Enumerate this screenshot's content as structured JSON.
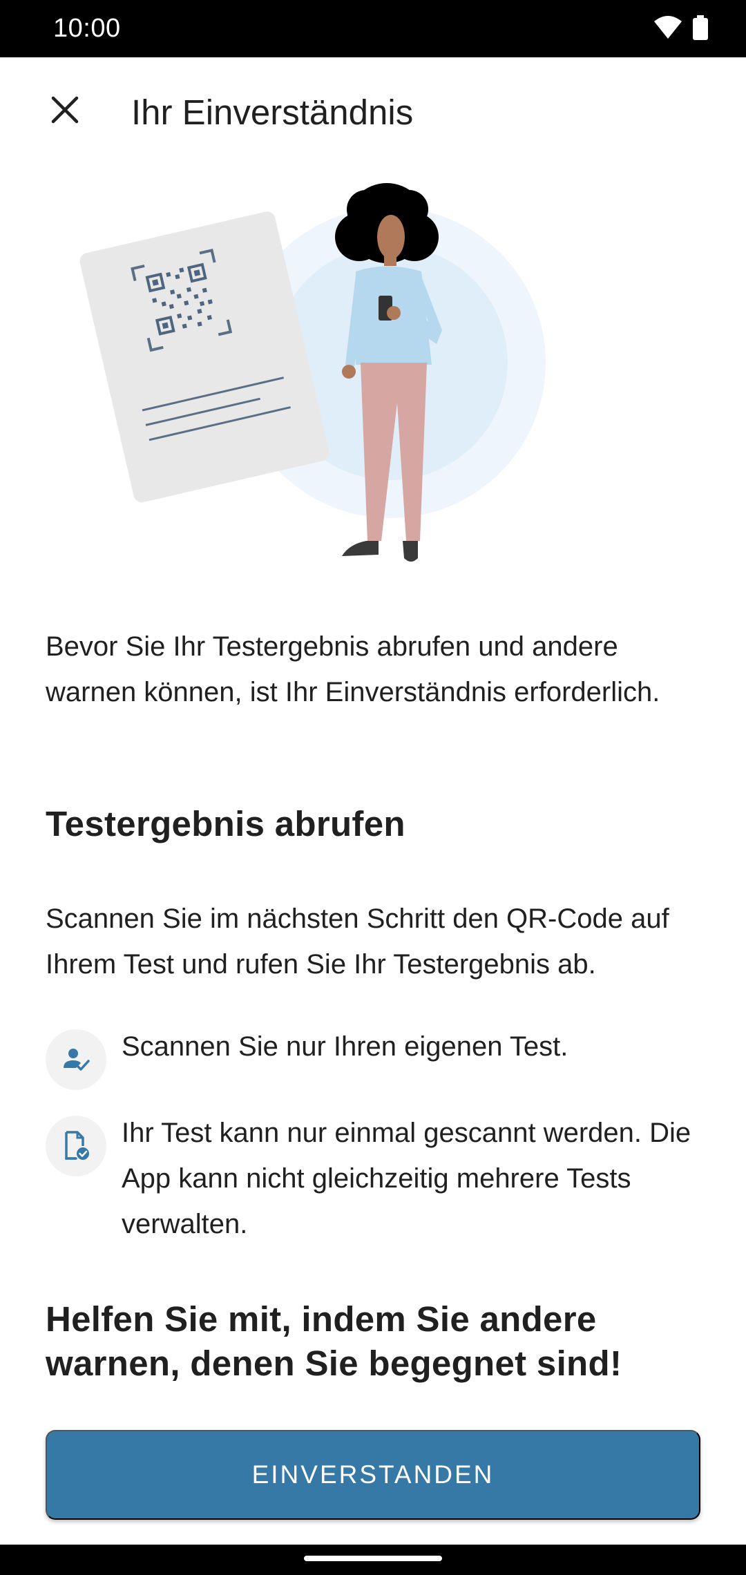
{
  "status_bar": {
    "time": "10:00",
    "icons": [
      "wifi-icon",
      "battery-icon"
    ]
  },
  "app_bar": {
    "title": "Ihr Einverständnis",
    "close_icon": "close-icon"
  },
  "illustration": {
    "description_icons": [
      "qr-document",
      "person-with-phone"
    ]
  },
  "intro": {
    "text": "Bevor Sie Ihr Testergebnis abrufen und andere warnen können, ist Ihr Einverständnis erforderlich."
  },
  "section": {
    "heading": "Testergebnis abrufen",
    "text": "Scannen Sie im nächsten Schritt den QR-Code auf Ihrem Test und rufen Sie Ihr Testergebnis ab.",
    "bullets": [
      {
        "icon": "user-check-icon",
        "text": "Scannen Sie nur Ihren eigenen Test."
      },
      {
        "icon": "document-check-icon",
        "text": "Ihr Test kann nur einmal gescannt werden. Die App kann nicht gleichzeitig mehrere Tests verwalten."
      }
    ]
  },
  "cta": {
    "heading": "Helfen Sie mit, indem Sie andere warnen, denen Sie begegnet sind!",
    "button_label": "EINVERSTANDEN"
  },
  "colors": {
    "primary": "#3779a6",
    "icon_blue": "#3779a6",
    "status_bar": "#000000"
  }
}
